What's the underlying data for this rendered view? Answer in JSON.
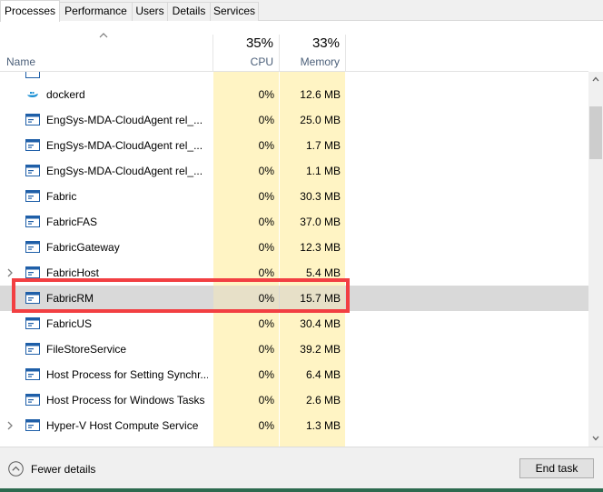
{
  "tabs": [
    {
      "label": "Processes",
      "active": true
    },
    {
      "label": "Performance",
      "active": false
    },
    {
      "label": "Users",
      "active": false
    },
    {
      "label": "Details",
      "active": false
    },
    {
      "label": "Services",
      "active": false
    }
  ],
  "header": {
    "name_label": "Name",
    "cpu_percent": "35%",
    "cpu_label": "CPU",
    "memory_percent": "33%",
    "memory_label": "Memory"
  },
  "rows": [
    {
      "name": "dockerd",
      "cpu": "0%",
      "memory": "12.6 MB",
      "icon": "whale-icon",
      "expandable": false,
      "selected": false
    },
    {
      "name": "EngSys-MDA-CloudAgent rel_...",
      "cpu": "0%",
      "memory": "25.0 MB",
      "icon": "window-icon",
      "expandable": false,
      "selected": false
    },
    {
      "name": "EngSys-MDA-CloudAgent rel_...",
      "cpu": "0%",
      "memory": "1.7 MB",
      "icon": "window-icon",
      "expandable": false,
      "selected": false
    },
    {
      "name": "EngSys-MDA-CloudAgent rel_...",
      "cpu": "0%",
      "memory": "1.1 MB",
      "icon": "window-icon",
      "expandable": false,
      "selected": false
    },
    {
      "name": "Fabric",
      "cpu": "0%",
      "memory": "30.3 MB",
      "icon": "window-icon",
      "expandable": false,
      "selected": false
    },
    {
      "name": "FabricFAS",
      "cpu": "0%",
      "memory": "37.0 MB",
      "icon": "window-icon",
      "expandable": false,
      "selected": false
    },
    {
      "name": "FabricGateway",
      "cpu": "0%",
      "memory": "12.3 MB",
      "icon": "window-icon",
      "expandable": false,
      "selected": false
    },
    {
      "name": "FabricHost",
      "cpu": "0%",
      "memory": "5.4 MB",
      "icon": "window-icon",
      "expandable": true,
      "selected": false
    },
    {
      "name": "FabricRM",
      "cpu": "0%",
      "memory": "15.7 MB",
      "icon": "window-icon",
      "expandable": false,
      "selected": true
    },
    {
      "name": "FabricUS",
      "cpu": "0%",
      "memory": "30.4 MB",
      "icon": "window-icon",
      "expandable": false,
      "selected": false
    },
    {
      "name": "FileStoreService",
      "cpu": "0%",
      "memory": "39.2 MB",
      "icon": "window-icon",
      "expandable": false,
      "selected": false
    },
    {
      "name": "Host Process for Setting Synchr...",
      "cpu": "0%",
      "memory": "6.4 MB",
      "icon": "window-icon",
      "expandable": false,
      "selected": false
    },
    {
      "name": "Host Process for Windows Tasks",
      "cpu": "0%",
      "memory": "2.6 MB",
      "icon": "window-icon",
      "expandable": false,
      "selected": false
    },
    {
      "name": "Hyper-V Host Compute Service",
      "cpu": "0%",
      "memory": "1.3 MB",
      "icon": "window-icon",
      "expandable": true,
      "selected": false
    }
  ],
  "footer": {
    "fewer_details_label": "Fewer details",
    "end_task_label": "End task"
  },
  "colors": {
    "heat_column": "#fff4c4",
    "selected_row": "#d9d9d9",
    "highlight_box": "#f23f42",
    "header_sublabel": "#4c607a"
  }
}
